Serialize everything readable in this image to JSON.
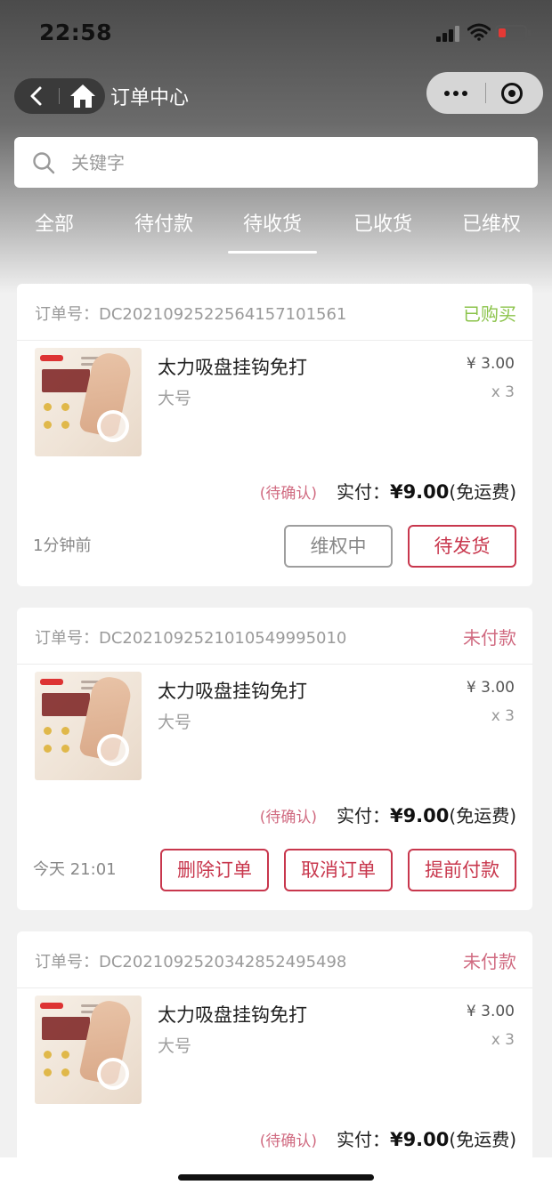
{
  "status_bar": {
    "time": "22:58"
  },
  "nav": {
    "title": "订单中心"
  },
  "search": {
    "placeholder": "关键字",
    "value": ""
  },
  "tabs": [
    {
      "label": "全部"
    },
    {
      "label": "待付款"
    },
    {
      "label": "待收货",
      "active": true
    },
    {
      "label": "已收货"
    },
    {
      "label": "已维权"
    }
  ],
  "orders": [
    {
      "order_no_label": "订单号：DC2021092522564157101561",
      "status": "已购买",
      "product_name": "太力吸盘挂钩免打",
      "spec": "大号",
      "price": "¥ 3.00",
      "qty": "x 3",
      "pending": "(待确认)",
      "paid_label": "实付：",
      "paid_amount": "¥9.00",
      "paid_note": "(免运费)",
      "time": "1分钟前",
      "buttons": [
        "维权中",
        "待发货"
      ]
    },
    {
      "order_no_label": "订单号：DC2021092521010549995010",
      "status": "未付款",
      "product_name": "太力吸盘挂钩免打",
      "spec": "大号",
      "price": "¥ 3.00",
      "qty": "x 3",
      "pending": "(待确认)",
      "paid_label": "实付：",
      "paid_amount": "¥9.00",
      "paid_note": "(免运费)",
      "time": "今天 21:01",
      "buttons": [
        "删除订单",
        "取消订单",
        "提前付款"
      ]
    },
    {
      "order_no_label": "订单号：DC2021092520342852495498",
      "status": "未付款",
      "product_name": "太力吸盘挂钩免打",
      "spec": "大号",
      "price": "¥ 3.00",
      "qty": "x 3",
      "pending": "(待确认)",
      "paid_label": "实付：",
      "paid_amount": "¥9.00",
      "paid_note": "(免运费)"
    }
  ],
  "colors": {
    "accent": "#c8374d",
    "status_bought": "#8bc34a",
    "status_unpaid": "#d06a80"
  },
  "icons": {
    "nav": [
      "back-arrow-icon",
      "home-icon",
      "more-dots-icon",
      "close-circle-icon"
    ],
    "search": "search-icon",
    "status": [
      "signal-icon",
      "wifi-icon",
      "battery-icon"
    ]
  }
}
